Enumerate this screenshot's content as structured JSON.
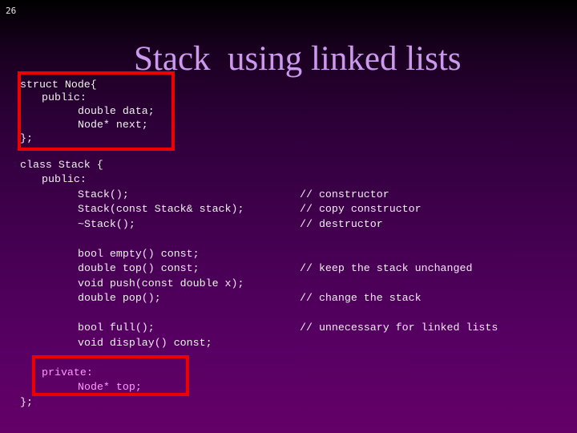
{
  "slide": {
    "number": "26",
    "title": "Stack  using linked lists"
  },
  "struct_block": {
    "lines": [
      "struct Node{",
      "public:",
      "double data;",
      "Node* next;",
      "};"
    ]
  },
  "class_block": {
    "header": "class Stack {",
    "public_label": "public:",
    "constructors": [
      "Stack();",
      "Stack(const Stack& stack);",
      "~Stack();"
    ],
    "queries": [
      "bool empty() const;",
      "double top() const;",
      "void push(const double x);",
      "double pop();"
    ],
    "extras": [
      "bool full();",
      "void display() const;"
    ],
    "private_label": "private:",
    "private_member": "Node* top;",
    "closing": "};"
  },
  "comments": {
    "constructor": "// constructor",
    "copy_constructor": "// copy constructor",
    "destructor": "// destructor",
    "keep": "// keep the stack unchanged",
    "change": "// change the stack",
    "unnecessary": "// unnecessary for linked lists"
  },
  "colors": {
    "title": "#cc99ee",
    "highlight_box": "#ee0000",
    "private_text": "#ff99ff"
  }
}
